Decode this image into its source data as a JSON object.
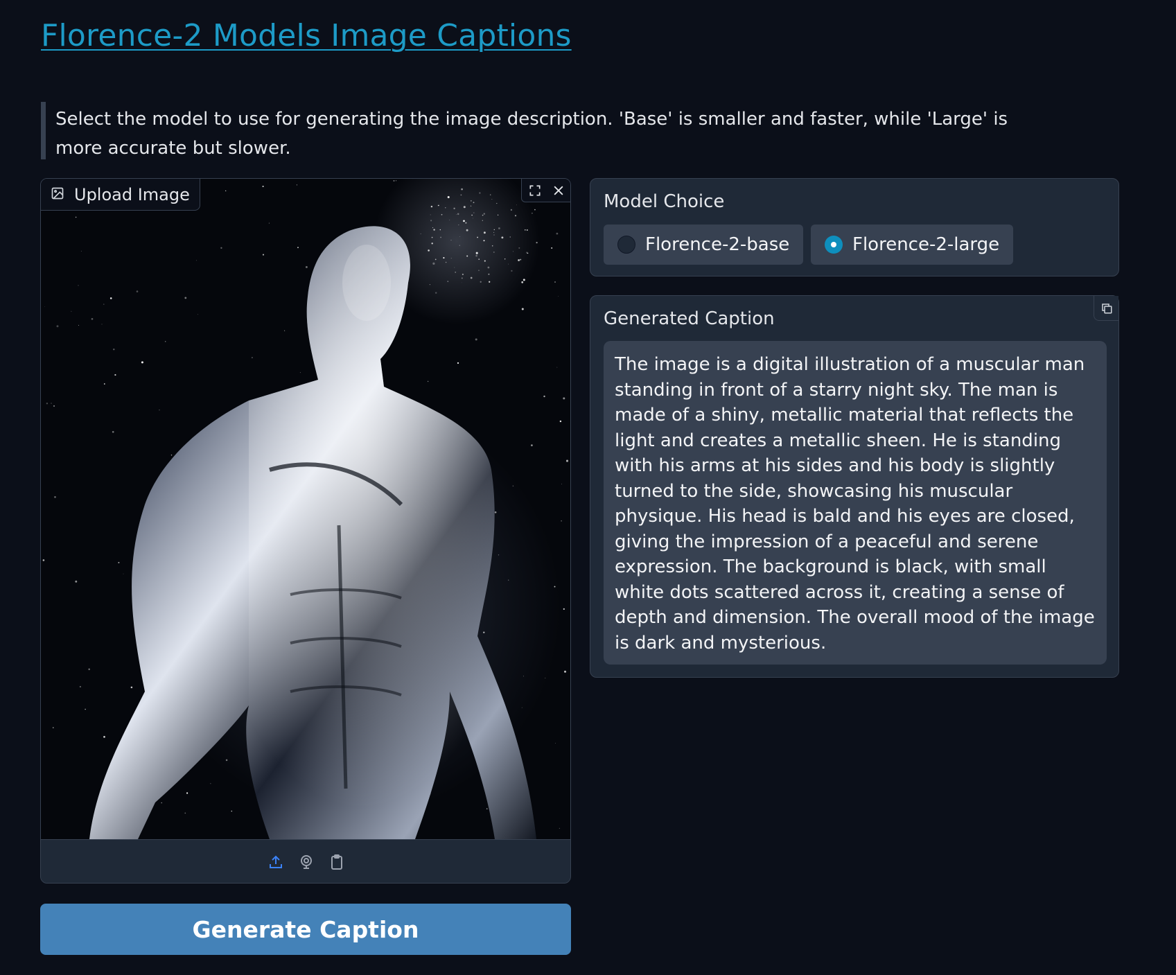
{
  "header": {
    "title": "Florence-2 Models Image Captions",
    "description": "Select the model to use for generating the image description. 'Base' is smaller and faster, while 'Large' is more accurate but slower."
  },
  "image_input": {
    "label": "Upload Image",
    "label_icon": "image-icon",
    "tools": [
      "fullscreen-icon",
      "close-icon"
    ],
    "footer_icons": [
      "upload-icon",
      "webcam-icon",
      "clipboard-icon"
    ],
    "image_description": "metallic chrome humanoid figure against starry night sky"
  },
  "model_choice": {
    "label": "Model Choice",
    "options": [
      "Florence-2-base",
      "Florence-2-large"
    ],
    "selected": "Florence-2-large"
  },
  "caption": {
    "label": "Generated Caption",
    "copy_icon": "copy-icon",
    "text": "The image is a digital illustration of a muscular man standing in front of a starry night sky. The man is made of a shiny, metallic material that reflects the light and creates a metallic sheen. He is standing with his arms at his sides and his body is slightly turned to the side, showcasing his muscular physique. His head is bald and his eyes are closed, giving the impression of a peaceful and serene expression. The background is black, with small white dots scattered across it, creating a sense of depth and dimension. The overall mood of the image is dark and mysterious."
  },
  "actions": {
    "generate_label": "Generate Caption"
  },
  "colors": {
    "background": "#0b0f19",
    "title": "#1d9bc7",
    "panel": "#1f2937",
    "border": "#374151",
    "button": "#4482b8",
    "radio_checked": "#0e8fbd"
  }
}
